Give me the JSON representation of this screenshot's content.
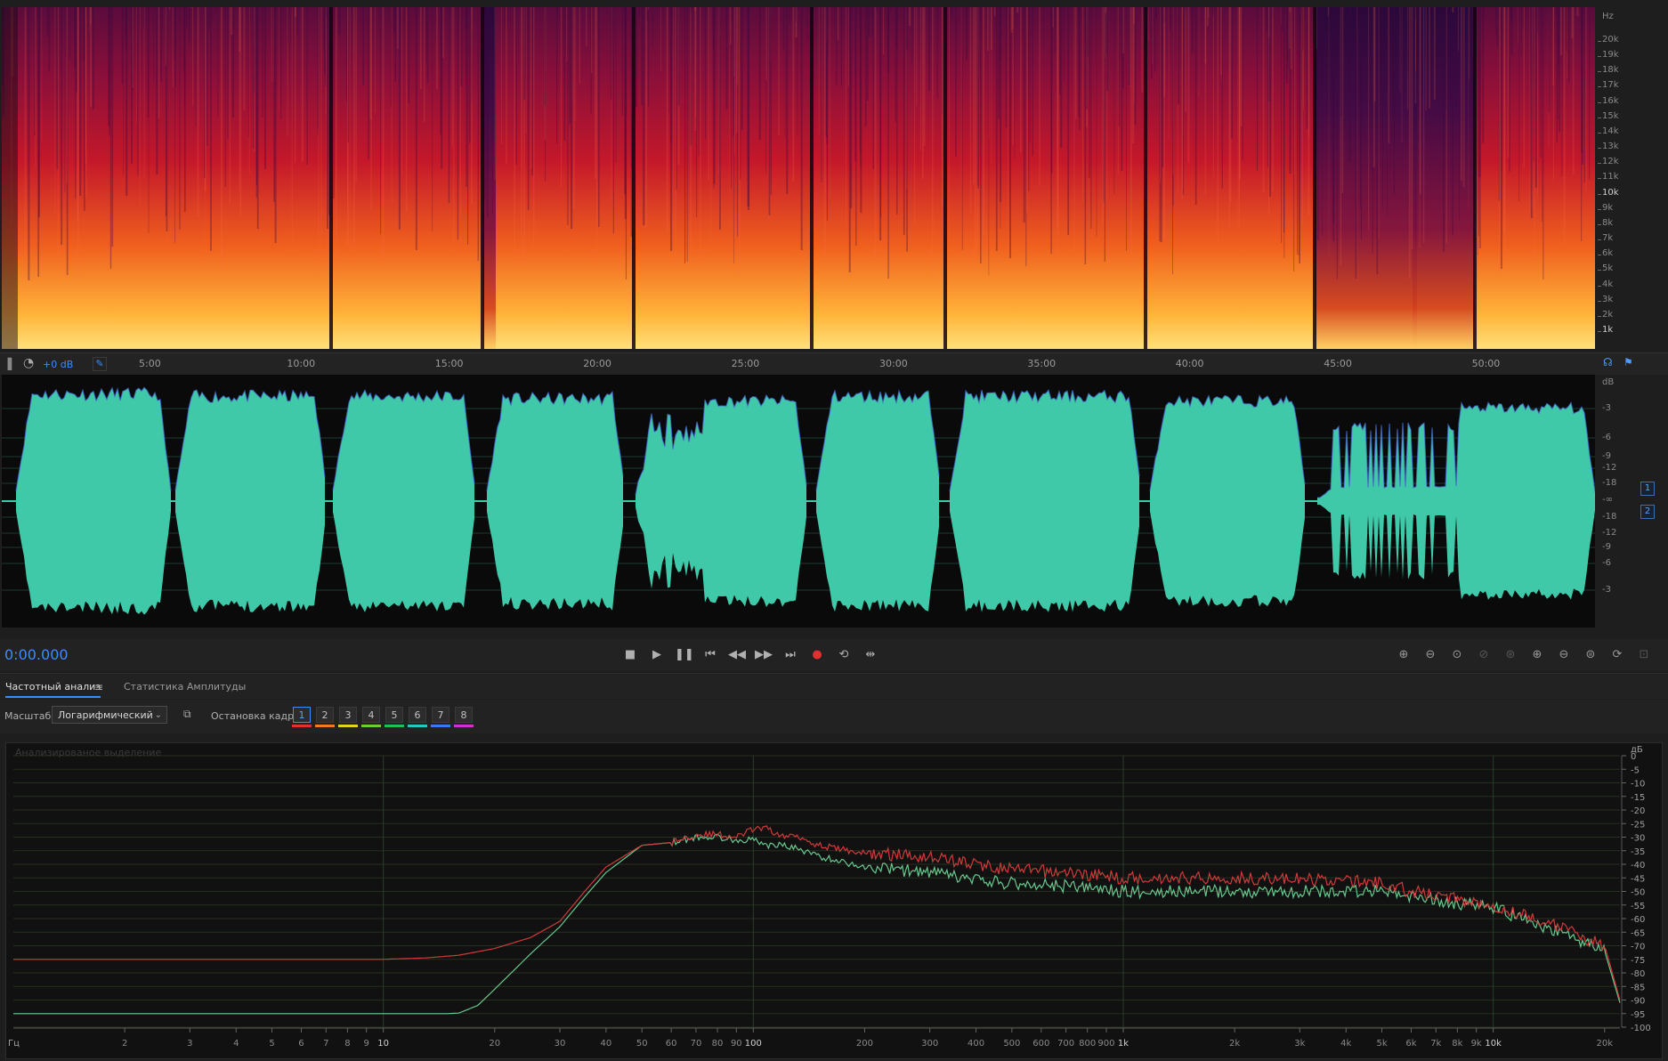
{
  "spectrogram": {
    "unit": "Hz",
    "freq_labels": [
      "20k",
      "19k",
      "18k",
      "17k",
      "16k",
      "15k",
      "14k",
      "13k",
      "12k",
      "11k",
      "10k",
      "9k",
      "8k",
      "7k",
      "6k",
      "5k",
      "4k",
      "3k",
      "2k",
      "1k"
    ]
  },
  "timeline": {
    "gain_label": "+0 dB",
    "time_labels": [
      "5:00",
      "10:00",
      "15:00",
      "20:00",
      "25:00",
      "30:00",
      "35:00",
      "40:00",
      "45:00",
      "50:00"
    ]
  },
  "waveform": {
    "unit": "dB",
    "db_labels_top": [
      "-3",
      "-6",
      "-9",
      "-12",
      "-18"
    ],
    "db_center": "-∞",
    "db_labels_bottom": [
      "-18",
      "-12",
      "-9",
      "-6",
      "-3"
    ],
    "channels": [
      "1",
      "2"
    ],
    "color": "#3fc9a8"
  },
  "transport": {
    "timecode": "0:00.000",
    "buttons": [
      "stop",
      "play",
      "pause",
      "skip-to-start",
      "rewind",
      "fast-forward",
      "skip-to-end",
      "record",
      "loop",
      "skip-selection"
    ]
  },
  "panel": {
    "tabs": [
      {
        "label": "Частотный анализ",
        "active": true
      },
      {
        "label": "Статистика Амплитуды",
        "active": false
      }
    ],
    "scale_label": "Масштаб:",
    "scale_value": "Логарифмический",
    "freeze_label": "Остановка кадра:",
    "frames": [
      {
        "label": "1",
        "color": "#e03030"
      },
      {
        "label": "2",
        "color": "#f07a20"
      },
      {
        "label": "3",
        "color": "#e8d020"
      },
      {
        "label": "4",
        "color": "#6ad030"
      },
      {
        "label": "5",
        "color": "#20c050"
      },
      {
        "label": "6",
        "color": "#20c8c8"
      },
      {
        "label": "7",
        "color": "#3a7af0"
      },
      {
        "label": "8",
        "color": "#d030d0"
      }
    ]
  },
  "chart_data": {
    "type": "line",
    "overlay_text": "Анализированое выделение",
    "xlabel": "Гц",
    "ylabel": "дБ",
    "xscale": "log",
    "xlim": [
      1,
      22000
    ],
    "ylim": [
      -100,
      0
    ],
    "x_ticks": [
      {
        "v": 2,
        "l": "2"
      },
      {
        "v": 3,
        "l": "3"
      },
      {
        "v": 4,
        "l": "4"
      },
      {
        "v": 5,
        "l": "5"
      },
      {
        "v": 6,
        "l": "6"
      },
      {
        "v": 7,
        "l": "7"
      },
      {
        "v": 8,
        "l": "8"
      },
      {
        "v": 9,
        "l": "9"
      },
      {
        "v": 10,
        "l": "10"
      },
      {
        "v": 20,
        "l": "20"
      },
      {
        "v": 30,
        "l": "30"
      },
      {
        "v": 40,
        "l": "40"
      },
      {
        "v": 50,
        "l": "50"
      },
      {
        "v": 60,
        "l": "60"
      },
      {
        "v": 70,
        "l": "70"
      },
      {
        "v": 80,
        "l": "80"
      },
      {
        "v": 90,
        "l": "90"
      },
      {
        "v": 100,
        "l": "100"
      },
      {
        "v": 200,
        "l": "200"
      },
      {
        "v": 300,
        "l": "300"
      },
      {
        "v": 400,
        "l": "400"
      },
      {
        "v": 500,
        "l": "500"
      },
      {
        "v": 600,
        "l": "600"
      },
      {
        "v": 700,
        "l": "700"
      },
      {
        "v": 800,
        "l": "800"
      },
      {
        "v": 900,
        "l": "900"
      },
      {
        "v": 1000,
        "l": "1k"
      },
      {
        "v": 2000,
        "l": "2k"
      },
      {
        "v": 3000,
        "l": "3k"
      },
      {
        "v": 4000,
        "l": "4k"
      },
      {
        "v": 5000,
        "l": "5k"
      },
      {
        "v": 6000,
        "l": "6k"
      },
      {
        "v": 7000,
        "l": "7k"
      },
      {
        "v": 8000,
        "l": "8k"
      },
      {
        "v": 9000,
        "l": "9k"
      },
      {
        "v": 10000,
        "l": "10k"
      },
      {
        "v": 20000,
        "l": "20k"
      }
    ],
    "y_ticks": [
      0,
      -5,
      -10,
      -15,
      -20,
      -25,
      -30,
      -35,
      -40,
      -45,
      -50,
      -55,
      -60,
      -65,
      -70,
      -75,
      -80,
      -85,
      -90,
      -95,
      -100
    ],
    "series": [
      {
        "name": "1",
        "color": "#d03a3a",
        "x": [
          1,
          5,
          10,
          13,
          16,
          20,
          25,
          30,
          35,
          40,
          50,
          60,
          70,
          80,
          90,
          100,
          110,
          120,
          130,
          150,
          200,
          300,
          400,
          500,
          700,
          1000,
          2000,
          4000,
          5000,
          6000,
          10000,
          15000,
          20000,
          22000
        ],
        "y": [
          -75,
          -75,
          -75,
          -74.5,
          -73.5,
          -71,
          -67,
          -61,
          -50,
          -41,
          -33,
          -32,
          -29,
          -29,
          -30,
          -27,
          -27,
          -30,
          -29,
          -33,
          -36,
          -37,
          -40,
          -42,
          -43,
          -45,
          -45,
          -46,
          -47,
          -50,
          -55,
          -63,
          -70,
          -90
        ]
      },
      {
        "name": "2",
        "color": "#66c98e",
        "x": [
          1,
          5,
          10,
          15,
          16,
          18,
          20,
          25,
          30,
          35,
          40,
          50,
          60,
          70,
          80,
          90,
          100,
          110,
          120,
          130,
          150,
          200,
          300,
          400,
          500,
          700,
          1000,
          2000,
          4000,
          5000,
          6000,
          10000,
          15000,
          20000,
          22000
        ],
        "y": [
          -95,
          -95,
          -95,
          -95,
          -94.8,
          -92,
          -86,
          -73,
          -63,
          -52,
          -43,
          -33,
          -32,
          -30,
          -30,
          -31,
          -31,
          -33,
          -33,
          -34,
          -37,
          -41,
          -43,
          -46,
          -47,
          -48,
          -50,
          -50,
          -50,
          -50,
          -52,
          -56,
          -65,
          -72,
          -91
        ]
      }
    ]
  }
}
